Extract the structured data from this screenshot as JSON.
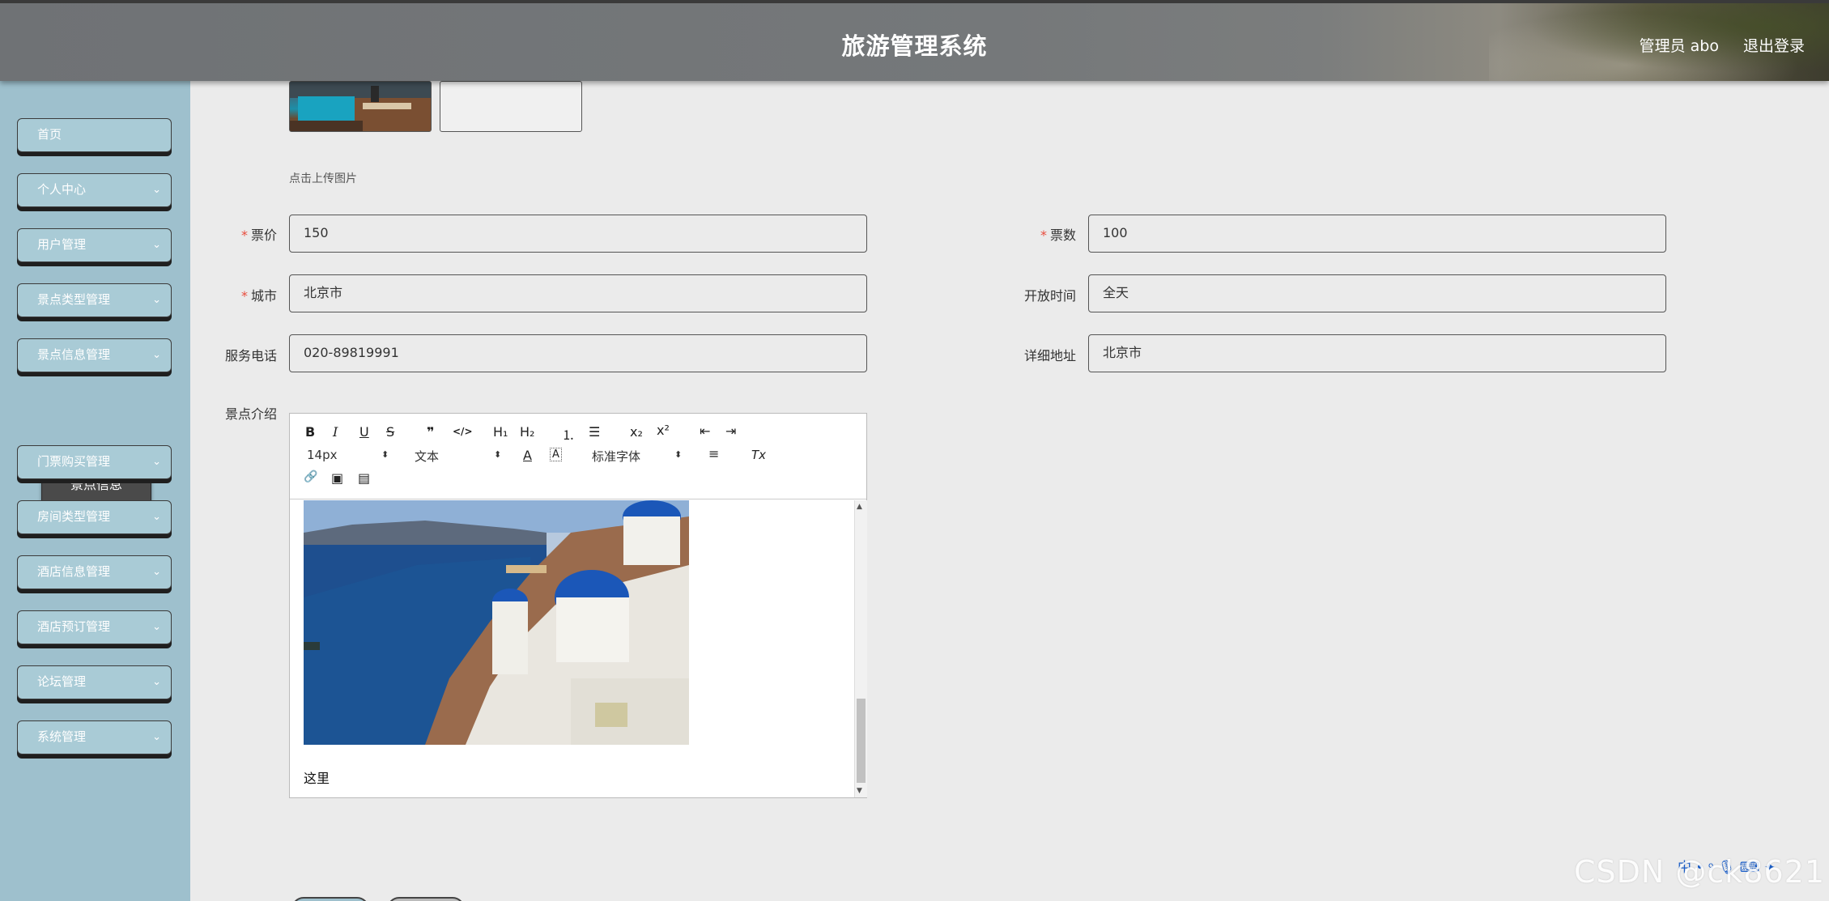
{
  "header": {
    "title": "旅游管理系统",
    "user_label": "管理员 abo",
    "logout_label": "退出登录"
  },
  "sidebar": {
    "items": [
      {
        "label": "首页",
        "has_chevron": false
      },
      {
        "label": "个人中心",
        "has_chevron": true
      },
      {
        "label": "用户管理",
        "has_chevron": true
      },
      {
        "label": "景点类型管理",
        "has_chevron": true
      },
      {
        "label": "景点信息管理",
        "has_chevron": true
      },
      {
        "label": "门票购买管理",
        "has_chevron": true
      },
      {
        "label": "房间类型管理",
        "has_chevron": true
      },
      {
        "label": "酒店信息管理",
        "has_chevron": true
      },
      {
        "label": "酒店预订管理",
        "has_chevron": true
      },
      {
        "label": "论坛管理",
        "has_chevron": true
      },
      {
        "label": "系统管理",
        "has_chevron": true
      }
    ],
    "chevron_glyph": "⌄",
    "submenu_label": "景点信息"
  },
  "upload": {
    "tip": "点击上传图片"
  },
  "form": {
    "price": {
      "label": "票价",
      "required": "*",
      "value": "150"
    },
    "tickets": {
      "label": "票数",
      "required": "*",
      "value": "100"
    },
    "city": {
      "label": "城市",
      "required": "*",
      "value": "北京市"
    },
    "open_time": {
      "label": "开放时间",
      "value": "全天"
    },
    "phone": {
      "label": "服务电话",
      "value": "020-89819991"
    },
    "address": {
      "label": "详细地址",
      "value": "北京市"
    },
    "intro": {
      "label": "景点介绍"
    }
  },
  "editor": {
    "toolbar": {
      "bold": "B",
      "italic": "I",
      "underline": "U",
      "strike": "S",
      "quote": "❞",
      "code": "</>",
      "h1": "H₁",
      "h2": "H₂",
      "ordered_list": "⒈",
      "bullet_list": "☰",
      "subscript": "x₂",
      "superscript": "x²",
      "outdent": "⇤",
      "indent": "⇥",
      "size": "14px",
      "format": "文本",
      "font": "标准字体",
      "color": "A",
      "background": "A",
      "align": "≡",
      "clear": "Tx",
      "link": "🔗",
      "image": "▣",
      "video": "▤",
      "select_arrows": "⬍"
    },
    "content_text": "这里"
  },
  "watermark": "CSDN @ck8621",
  "ime": "中 • ꝰ 🎙 ⌨ ✦"
}
